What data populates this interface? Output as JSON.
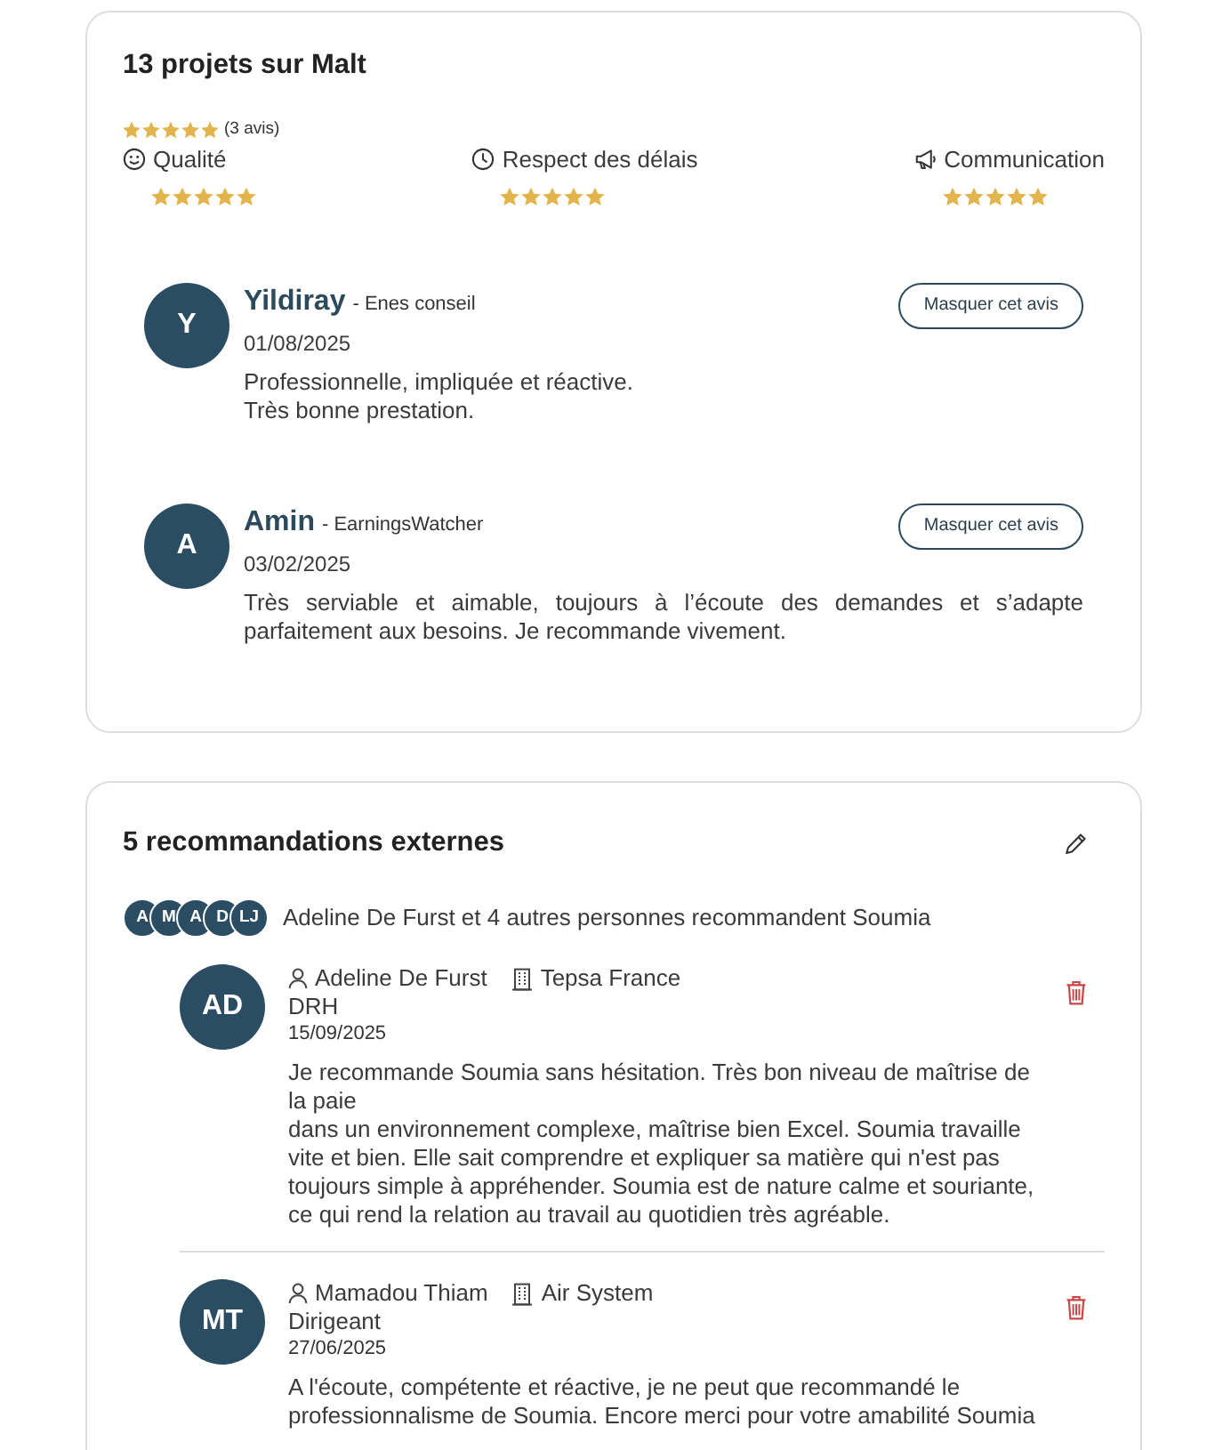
{
  "malt_reviews": {
    "title": "13 projets sur Malt",
    "overall": {
      "stars": 5,
      "count": "(3 avis)"
    },
    "criteria": [
      {
        "label": "Qualité",
        "stars": 5
      },
      {
        "label": "Respect des délais",
        "stars": 5
      },
      {
        "label": "Communication",
        "stars": 5
      }
    ],
    "reviews": [
      {
        "initials": "Y",
        "name": "Yildiray",
        "company": "- Enes conseil",
        "date": "01/08/2025",
        "text": "Professionnelle, impliquée et réactive.\nTrès bonne prestation.",
        "button": "Masquer cet avis"
      },
      {
        "initials": "A",
        "name": "Amin",
        "company": "- EarningsWatcher",
        "date": "03/02/2025",
        "text": "Très serviable et aimable, toujours à l’écoute des demandes et s’adapte parfaitement aux besoins. Je recommande vivement.",
        "button": "Masquer cet avis"
      }
    ]
  },
  "external_recommendations": {
    "title": "5 recommandations externes",
    "avatars": [
      "A",
      "M",
      "A",
      "D",
      "LJ"
    ],
    "summary": "Adeline De Furst et 4 autres personnes recommandent Soumia",
    "items": [
      {
        "initials": "AD",
        "name": "Adeline De Furst",
        "company": "Tepsa France",
        "role": "DRH",
        "date": "15/09/2025",
        "text": "Je recommande Soumia sans hésitation. Très bon niveau de maîtrise de la paie\ndans un environnement complexe, maîtrise bien Excel. Soumia travaille vite et bien. Elle sait comprendre et expliquer sa matière qui n'est pas toujours simple à appréhender. Soumia est de nature calme et souriante, ce qui rend la relation au travail au quotidien très agréable."
      },
      {
        "initials": "MT",
        "name": "Mamadou Thiam",
        "company": "Air System",
        "role": "Dirigeant",
        "date": "27/06/2025",
        "text": "A l'écoute, compétente et réactive, je ne peut que recommandé le professionnalisme de Soumia. Encore merci pour votre amabilité Soumia"
      }
    ]
  }
}
